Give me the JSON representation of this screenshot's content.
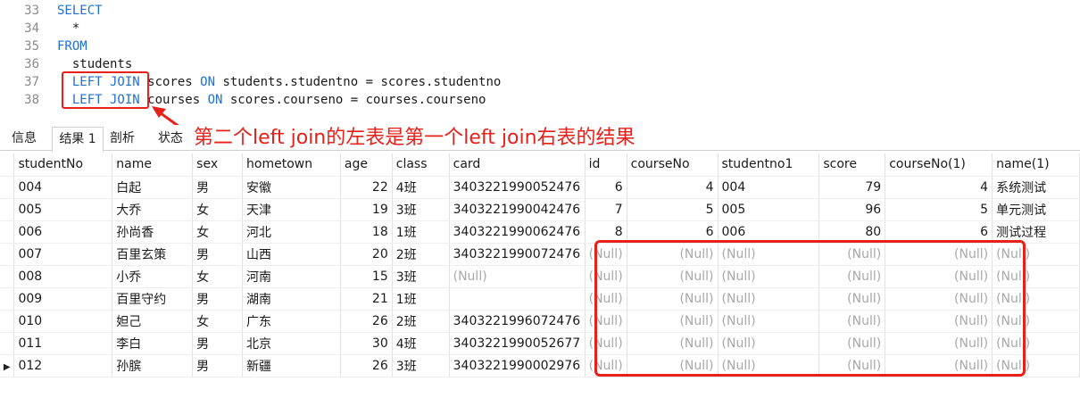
{
  "editor": {
    "lines": [
      {
        "no": "33",
        "parts": [
          {
            "t": "SELECT",
            "kw": true
          }
        ]
      },
      {
        "no": "34",
        "parts": [
          {
            "t": "  *",
            "kw": false
          }
        ]
      },
      {
        "no": "35",
        "parts": [
          {
            "t": "FROM",
            "kw": true
          }
        ]
      },
      {
        "no": "36",
        "parts": [
          {
            "t": "  students",
            "kw": false
          }
        ]
      },
      {
        "no": "37",
        "parts": [
          {
            "t": "  ",
            "kw": false
          },
          {
            "t": "LEFT JOIN",
            "kw": true
          },
          {
            "t": " scores ",
            "kw": false
          },
          {
            "t": "ON",
            "kw": true
          },
          {
            "t": " students.studentno = scores.studentno",
            "kw": false
          }
        ]
      },
      {
        "no": "38",
        "parts": [
          {
            "t": "  ",
            "kw": false
          },
          {
            "t": "LEFT JOIN",
            "kw": true
          },
          {
            "t": " courses ",
            "kw": false
          },
          {
            "t": "ON",
            "kw": true
          },
          {
            "t": " scores.courseno = courses.courseno",
            "kw": false
          }
        ]
      }
    ]
  },
  "annotation": "第二个left join的左表是第一个left join右表的结果",
  "colors": {
    "accent": "#e8201a",
    "keyword": "#1f6fd6",
    "null_text": "#a8a8a8"
  },
  "tabs": [
    {
      "label": "信息"
    },
    {
      "label": "结果 1"
    },
    {
      "label": "剖析"
    },
    {
      "label": "状态"
    }
  ],
  "grid": {
    "columns": [
      "studentNo",
      "name",
      "sex",
      "hometown",
      "age",
      "class",
      "card",
      "id",
      "courseNo",
      "studentno1",
      "score",
      "courseNo(1)",
      "name(1)"
    ],
    "rows": [
      [
        "004",
        "白起",
        "男",
        "安徽",
        "22",
        "4班",
        "3403221990052476",
        "6",
        "4",
        "004",
        "79",
        "4",
        "系统测试"
      ],
      [
        "005",
        "大乔",
        "女",
        "天津",
        "19",
        "3班",
        "3403221990042476",
        "7",
        "5",
        "005",
        "96",
        "5",
        "单元测试"
      ],
      [
        "006",
        "孙尚香",
        "女",
        "河北",
        "18",
        "1班",
        "3403221990062476",
        "8",
        "6",
        "006",
        "80",
        "6",
        "测试过程"
      ],
      [
        "007",
        "百里玄策",
        "男",
        "山西",
        "20",
        "2班",
        "3403221990072476",
        "(Null)",
        "(Null)",
        "(Null)",
        "(Null)",
        "(Null)",
        "(Null)"
      ],
      [
        "008",
        "小乔",
        "女",
        "河南",
        "15",
        "3班",
        "(Null)",
        "(Null)",
        "(Null)",
        "(Null)",
        "(Null)",
        "(Null)",
        "(Null)"
      ],
      [
        "009",
        "百里守约",
        "男",
        "湖南",
        "21",
        "1班",
        "",
        "(Null)",
        "(Null)",
        "(Null)",
        "(Null)",
        "(Null)",
        "(Null)"
      ],
      [
        "010",
        "妲己",
        "女",
        "广东",
        "26",
        "2班",
        "3403221996072476",
        "(Null)",
        "(Null)",
        "(Null)",
        "(Null)",
        "(Null)",
        "(Null)"
      ],
      [
        "011",
        "李白",
        "男",
        "北京",
        "30",
        "4班",
        "3403221990052677",
        "(Null)",
        "(Null)",
        "(Null)",
        "(Null)",
        "(Null)",
        "(Null)"
      ],
      [
        "012",
        "孙膑",
        "男",
        "新疆",
        "26",
        "3班",
        "3403221990002976",
        "(Null)",
        "(Null)",
        "(Null)",
        "(Null)",
        "(Null)",
        "(Null)"
      ]
    ]
  }
}
